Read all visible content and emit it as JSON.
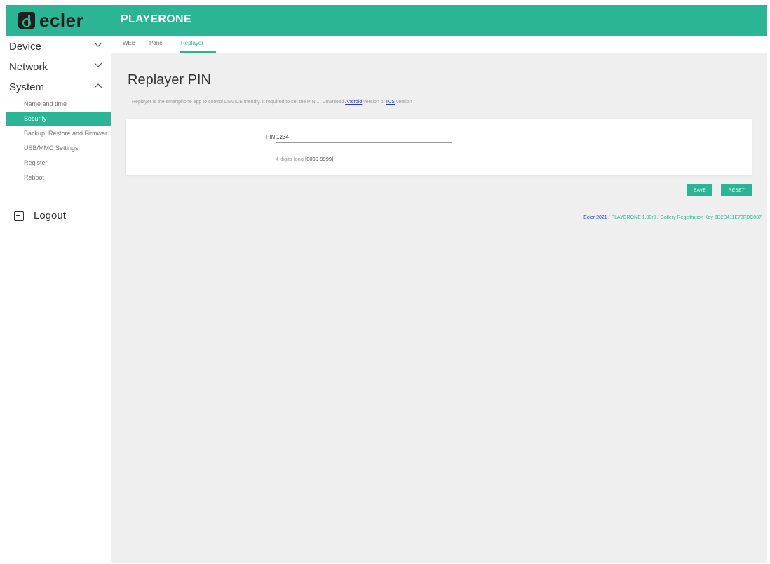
{
  "header": {
    "logo_text": "ecler",
    "app_title": "PLAYERONE",
    "accent_color": "#2bb594"
  },
  "sidebar": {
    "groups": [
      {
        "label": "Device",
        "state": "collapsed"
      },
      {
        "label": "Network",
        "state": "collapsed"
      },
      {
        "label": "System",
        "state": "expanded"
      }
    ],
    "system_items": [
      {
        "label": "Name and time"
      },
      {
        "label": "Security",
        "active": true
      },
      {
        "label": "Backup, Restore and Firmwar"
      },
      {
        "label": "USB/MMC Settings"
      },
      {
        "label": "Register"
      },
      {
        "label": "Reboot"
      }
    ],
    "logout_label": "Logout"
  },
  "tabs": [
    {
      "label": "WEB"
    },
    {
      "label": "Panel"
    },
    {
      "label": "Replayer",
      "active": true
    }
  ],
  "main": {
    "title": "Replayer PIN",
    "description_pre": "Replayer is the smartphone app to control DEVICE friendly. It required to set the PIN ... Download ",
    "android_link": "Android",
    "description_mid": " version or ",
    "ios_link": "IOS",
    "description_post": " version",
    "pin_label": "PIN",
    "pin_value": "1234",
    "hint_pre": "4 digits long ",
    "hint_range": "[0000-9999]",
    "save_label": "SAVE",
    "reset_label": "RESET"
  },
  "footer": {
    "link_text": "Ecler 2021",
    "rest": " / PLAYERONE 1.00r0 / Gallery Registration Key 6D2B411E73FDC087"
  }
}
